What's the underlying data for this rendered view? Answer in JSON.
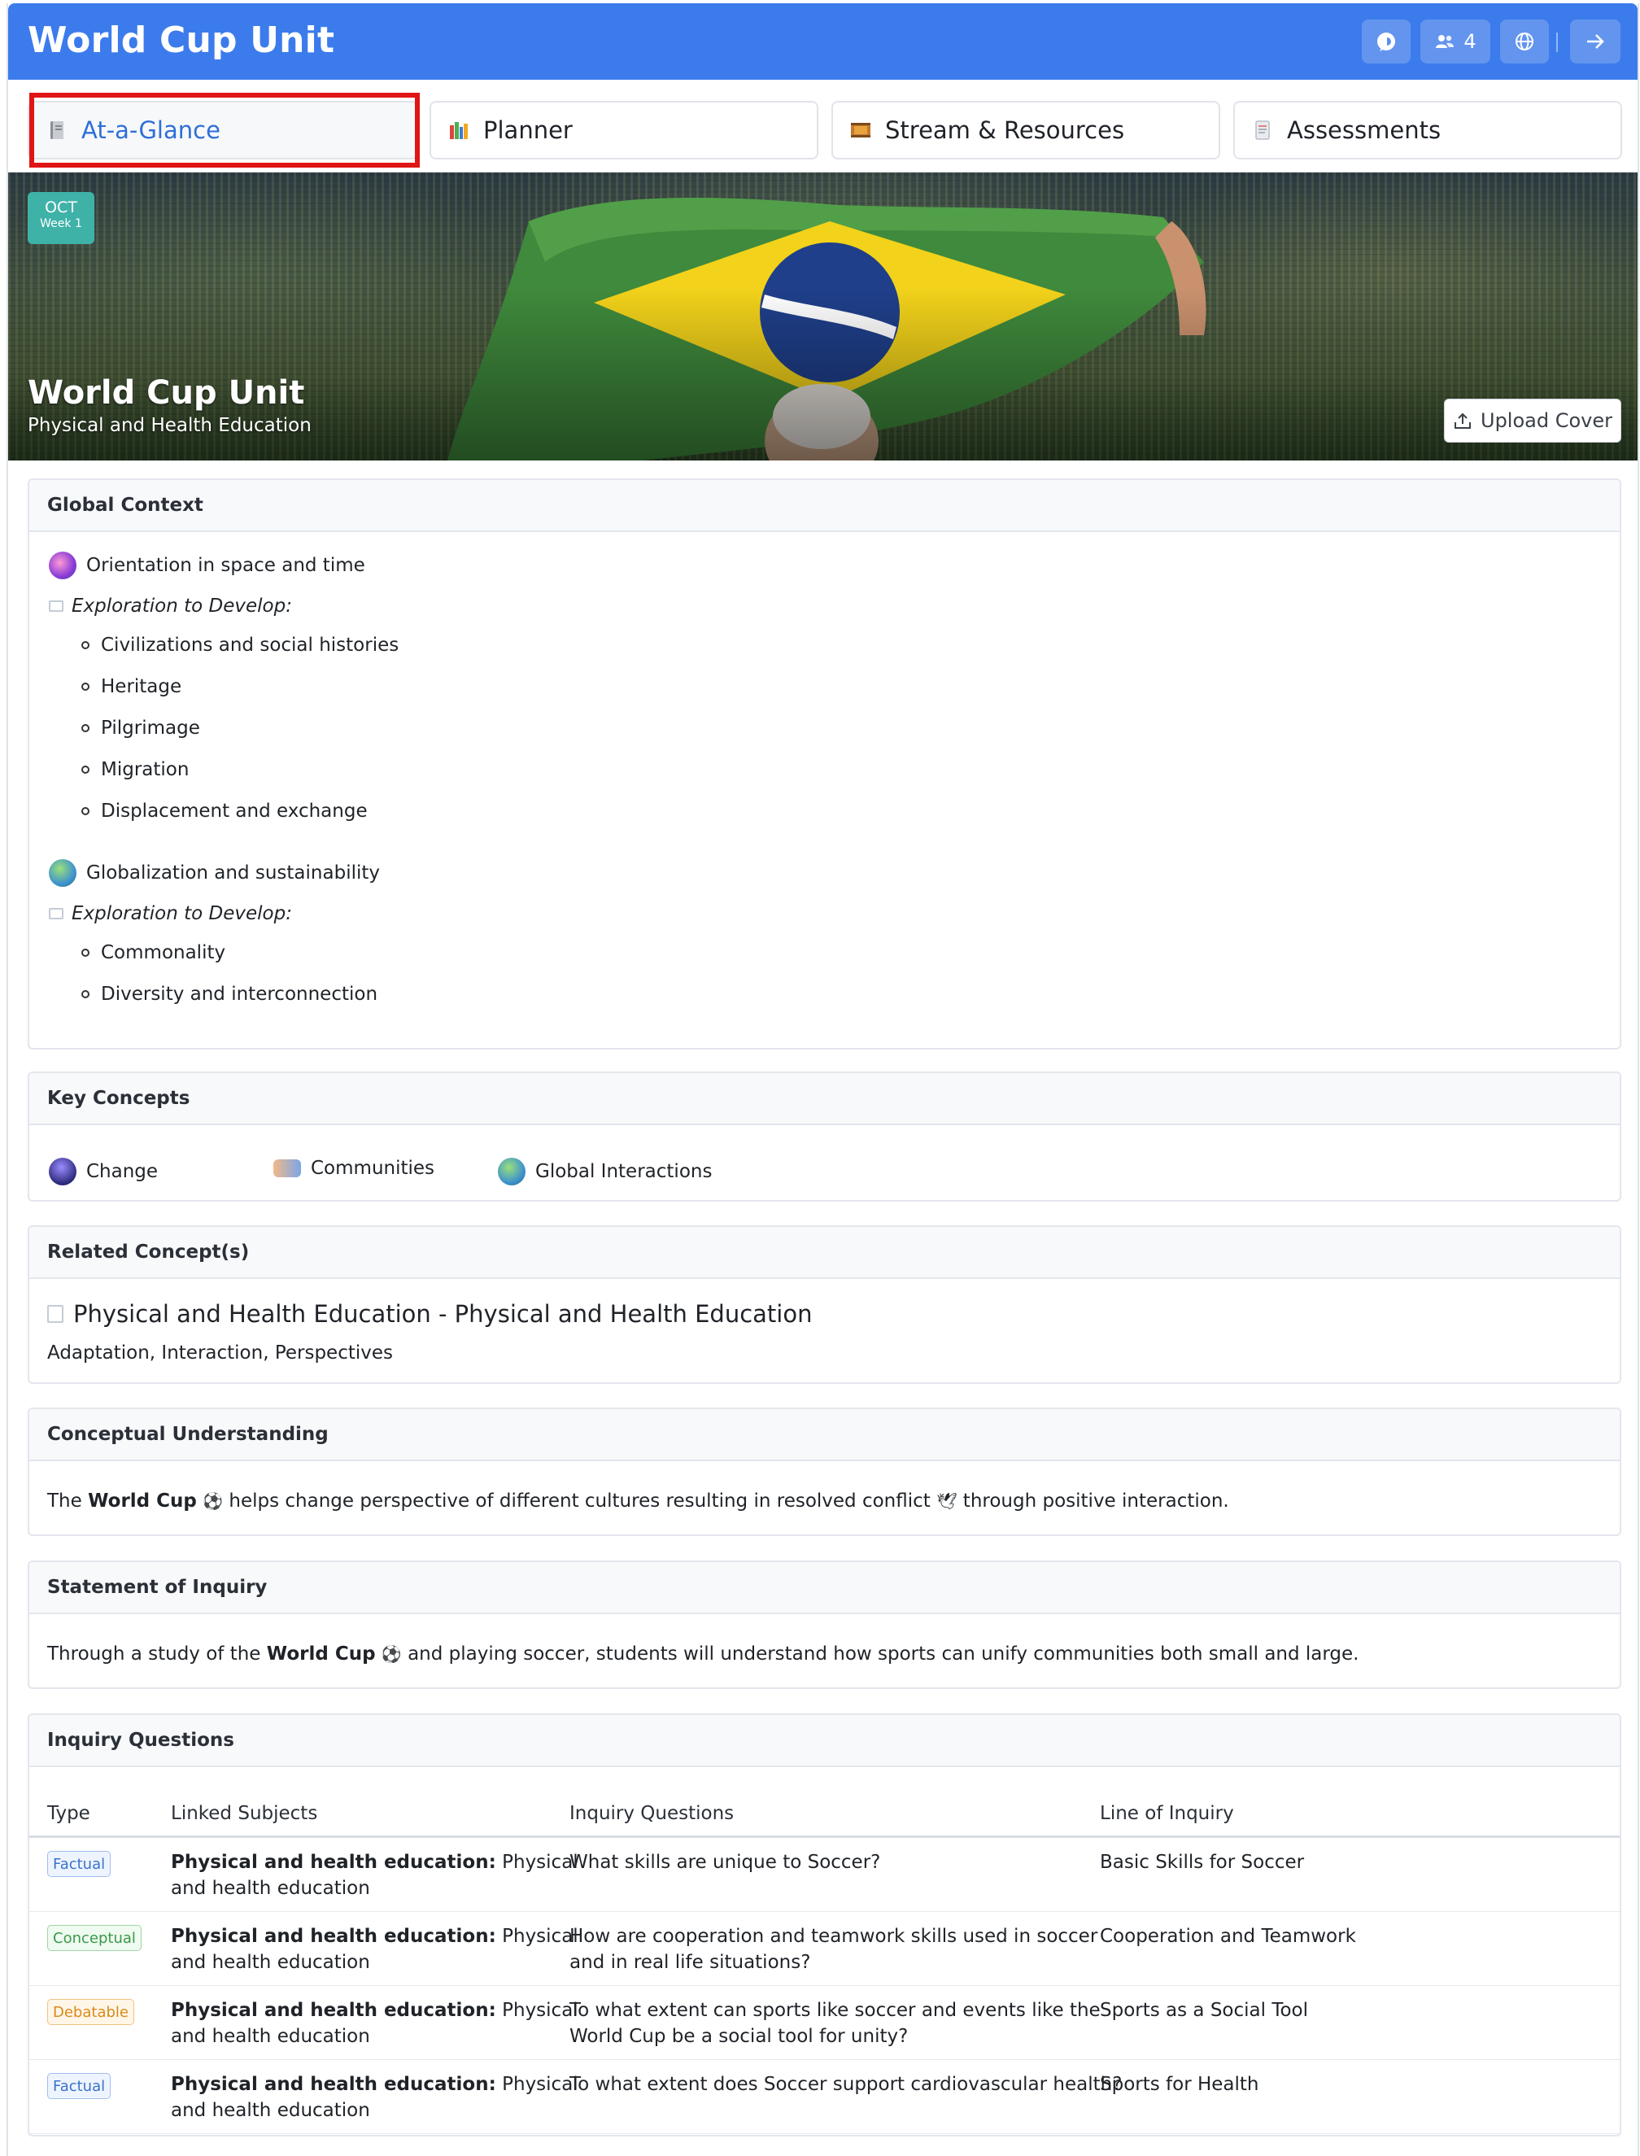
{
  "header": {
    "title": "World Cup Unit",
    "members_count": "4"
  },
  "tabs": [
    {
      "label": "At-a-Glance",
      "icon": "notebook-icon"
    },
    {
      "label": "Planner",
      "icon": "books-icon"
    },
    {
      "label": "Stream & Resources",
      "icon": "film-strip-icon"
    },
    {
      "label": "Assessments",
      "icon": "document-icon"
    }
  ],
  "hero": {
    "month": "OCT",
    "week": "Week 1",
    "title": "World Cup Unit",
    "subtitle": "Physical and Health Education",
    "upload_label": "Upload Cover"
  },
  "global_context": {
    "heading": "Global Context",
    "contexts": [
      {
        "name": "Orientation in space and time",
        "explore_label": "Exploration to Develop:",
        "items": [
          "Civilizations and social histories",
          "Heritage",
          "Pilgrimage",
          "Migration",
          "Displacement and exchange"
        ]
      },
      {
        "name": "Globalization and sustainability",
        "explore_label": "Exploration to Develop:",
        "items": [
          "Commonality",
          "Diversity and interconnection"
        ]
      }
    ]
  },
  "key_concepts": {
    "heading": "Key Concepts",
    "items": [
      "Change",
      "Communities",
      "Global Interactions"
    ]
  },
  "related_concepts": {
    "heading": "Related Concept(s)",
    "title": "Physical and Health Education - Physical and Health Education",
    "list": "Adaptation, Interaction, Perspectives"
  },
  "conceptual_understanding": {
    "heading": "Conceptual Understanding",
    "p1": "The ",
    "bold": "World Cup",
    "p2": " helps change perspective of different cultures resulting in resolved conflict ",
    "p3": " through positive interaction."
  },
  "statement_of_inquiry": {
    "heading": "Statement of Inquiry",
    "p1": "Through a study of the ",
    "bold": "World Cup",
    "p2": " and playing soccer, students will understand how sports can unify communities both small and large."
  },
  "inquiry_questions": {
    "heading": "Inquiry Questions",
    "columns": [
      "Type",
      "Linked Subjects",
      "Inquiry Questions",
      "Line of Inquiry"
    ],
    "rows": [
      {
        "type": "Factual",
        "subject_bold": "Physical and health education:",
        "subject_l1": " Physical",
        "subject_l2": "and health education",
        "q1": "What skills are unique to Soccer?",
        "q2": "",
        "line": "Basic Skills for Soccer"
      },
      {
        "type": "Conceptual",
        "subject_bold": "Physical and health education:",
        "subject_l1": " Physical",
        "subject_l2": "and health education",
        "q1": "How are cooperation and teamwork skills used in soccer",
        "q2": "and in real life situations?",
        "line": "Cooperation and Teamwork"
      },
      {
        "type": "Debatable",
        "subject_bold": "Physical and health education:",
        "subject_l1": " Physical",
        "subject_l2": "and health education",
        "q1": "To what extent can sports like soccer and events like the",
        "q2": "World Cup be a social tool for unity?",
        "line": "Sports as a Social Tool"
      },
      {
        "type": "Factual",
        "subject_bold": "Physical and health education:",
        "subject_l1": " Physical",
        "subject_l2": "and health education",
        "q1": "To what extent does Soccer support cardiovascular health?",
        "q2": "",
        "line": "Sports for Health"
      }
    ]
  },
  "colors": {
    "header_bg": "#3c7bec",
    "active_tab_text": "#2e6fd8",
    "date_badge": "#3fb2a8",
    "highlight_box": "#e01515"
  }
}
